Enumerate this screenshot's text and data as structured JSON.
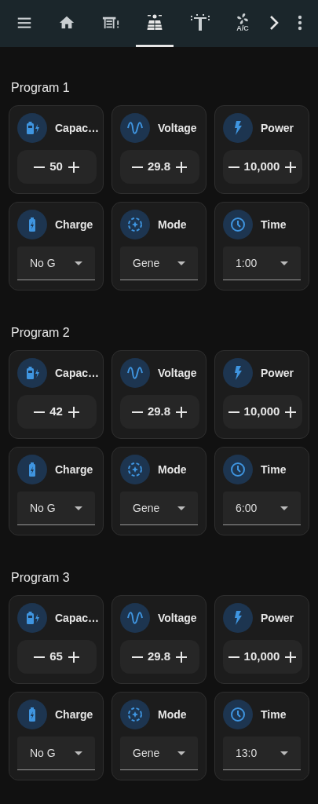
{
  "tabs": [
    {
      "kind": "menu",
      "selected": false
    },
    {
      "kind": "home",
      "selected": false
    },
    {
      "kind": "garage",
      "selected": false
    },
    {
      "kind": "solar",
      "selected": true
    },
    {
      "kind": "tower",
      "selected": false
    },
    {
      "kind": "fan",
      "label": "A/C",
      "selected": false
    },
    {
      "kind": "chevron",
      "selected": false
    },
    {
      "kind": "more",
      "selected": false
    }
  ],
  "programs": [
    {
      "title": "Program 1",
      "cards": [
        {
          "kind": "stepper",
          "label": "Capac…",
          "value": "50"
        },
        {
          "kind": "stepper",
          "label": "Voltage",
          "value": "29.8"
        },
        {
          "kind": "stepper",
          "label": "Power",
          "value": "10,000"
        },
        {
          "kind": "select",
          "label": "Charge",
          "value": "No G"
        },
        {
          "kind": "select",
          "label": "Mode",
          "value": "Gene"
        },
        {
          "kind": "select",
          "label": "Time",
          "value": "1:00"
        }
      ]
    },
    {
      "title": "Program 2",
      "cards": [
        {
          "kind": "stepper",
          "label": "Capac…",
          "value": "42"
        },
        {
          "kind": "stepper",
          "label": "Voltage",
          "value": "29.8"
        },
        {
          "kind": "stepper",
          "label": "Power",
          "value": "10,000"
        },
        {
          "kind": "select",
          "label": "Charge",
          "value": "No G"
        },
        {
          "kind": "select",
          "label": "Mode",
          "value": "Gene"
        },
        {
          "kind": "select",
          "label": "Time",
          "value": "6:00"
        }
      ]
    },
    {
      "title": "Program 3",
      "cards": [
        {
          "kind": "stepper",
          "label": "Capac…",
          "value": "65"
        },
        {
          "kind": "stepper",
          "label": "Voltage",
          "value": "29.8"
        },
        {
          "kind": "stepper",
          "label": "Power",
          "value": "10,000"
        },
        {
          "kind": "select",
          "label": "Charge",
          "value": "No G"
        },
        {
          "kind": "select",
          "label": "Mode",
          "value": "Gene"
        },
        {
          "kind": "select",
          "label": "Time",
          "value": "13:0"
        }
      ]
    }
  ]
}
